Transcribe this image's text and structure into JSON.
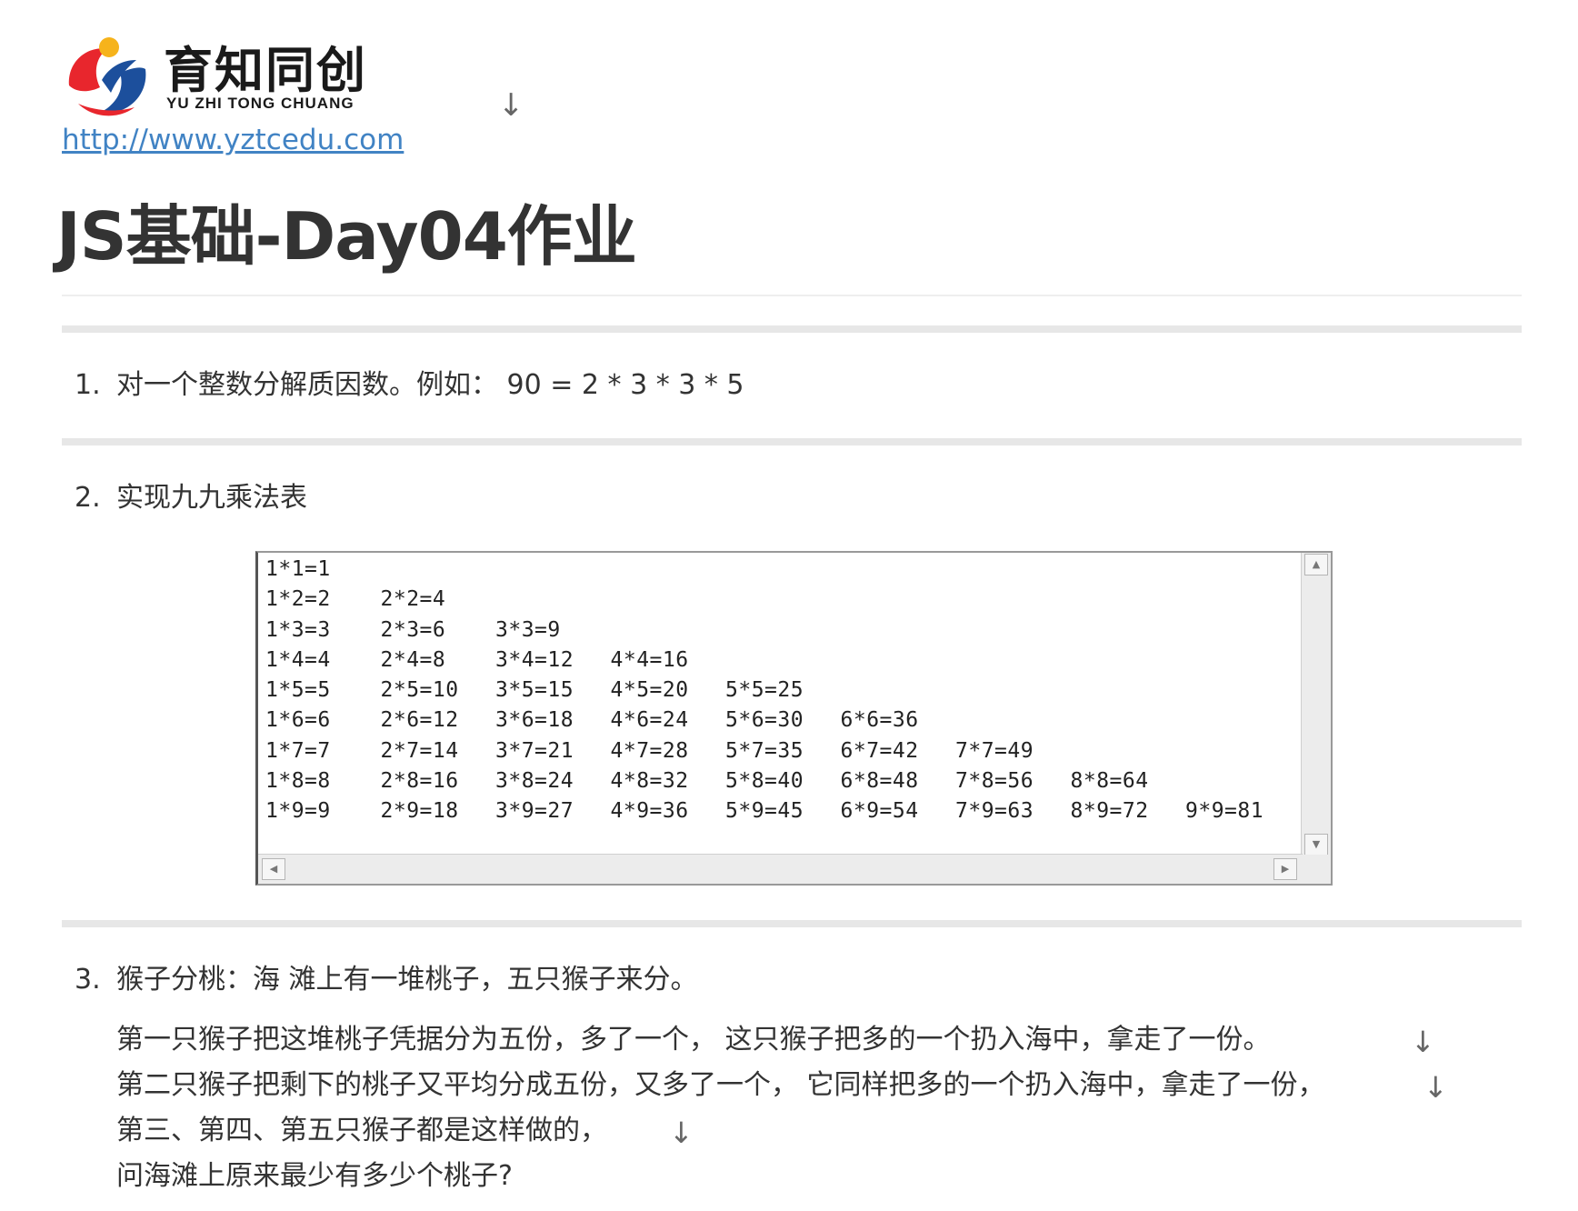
{
  "header": {
    "logo_cn": "育知同创",
    "logo_en": "YU ZHI TONG CHUANG",
    "arrow": "↓",
    "link": "http://www.yztcedu.com"
  },
  "title": "JS基础-Day04作业",
  "items": [
    {
      "num": "1.",
      "text": "对一个整数分解质因数。例如： 90 = 2 * 3 * 3 * 5"
    },
    {
      "num": "2.",
      "text": "实现九九乘法表"
    },
    {
      "num": "3.",
      "text": "猴子分桃：海 滩上有一堆桃子，五只猴子来分。"
    }
  ],
  "table_rows": [
    [
      "1*1=1"
    ],
    [
      "1*2=2",
      "2*2=4"
    ],
    [
      "1*3=3",
      "2*3=6",
      "3*3=9"
    ],
    [
      "1*4=4",
      "2*4=8",
      "3*4=12",
      "4*4=16"
    ],
    [
      "1*5=5",
      "2*5=10",
      "3*5=15",
      "4*5=20",
      "5*5=25"
    ],
    [
      "1*6=6",
      "2*6=12",
      "3*6=18",
      "4*6=24",
      "5*6=30",
      "6*6=36"
    ],
    [
      "1*7=7",
      "2*7=14",
      "3*7=21",
      "4*7=28",
      "5*7=35",
      "6*7=42",
      "7*7=49"
    ],
    [
      "1*8=8",
      "2*8=16",
      "3*8=24",
      "4*8=32",
      "5*8=40",
      "6*8=48",
      "7*8=56",
      "8*8=64"
    ],
    [
      "1*9=9",
      "2*9=18",
      "3*9=27",
      "4*9=36",
      "5*9=45",
      "6*9=54",
      "7*9=63",
      "8*9=72",
      "9*9=81"
    ]
  ],
  "scroll_arrows": {
    "up": "▲",
    "down": "▼",
    "left": "◀",
    "right": "▶"
  },
  "paragraphs": [
    {
      "text": "第一只猴子把这堆桃子凭据分为五份，多了一个， 这只猴子把多的一个扔入海中，拿走了一份。",
      "arrow": "↓"
    },
    {
      "text": "第二只猴子把剩下的桃子又平均分成五份，又多了一个， 它同样把多的一个扔入海中，拿走了一份，",
      "arrow": "↓"
    },
    {
      "text": "第三、第四、第五只猴子都是这样做的，",
      "arrow": "↓"
    },
    {
      "text": "问海滩上原来最少有多少个桃子?"
    }
  ],
  "colors": {
    "link": "#4183c4",
    "logo_red": "#e8262d",
    "logo_blue": "#1c4f9c",
    "logo_yellow": "#f6b31b",
    "rule": "#e7e7e7"
  }
}
